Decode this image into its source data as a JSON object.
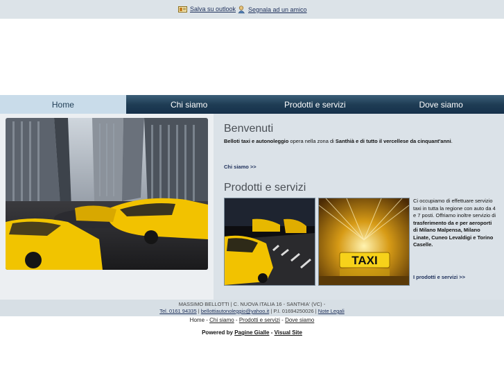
{
  "topbar": {
    "outlook_label": "Salva su outlook",
    "friend_label": "Segnala ad un amico"
  },
  "nav": {
    "items": [
      "Home",
      "Chi siamo",
      "Prodotti e servizi",
      "Dove siamo"
    ],
    "active": "Home"
  },
  "welcome": {
    "title": "Benvenuti",
    "company": "Belloti taxi e autonoleggio",
    "text_1": " opera nella zona di ",
    "place": "Santhià e di tutto il vercellese da cinquant'anni",
    "end": ".",
    "more_link": "Chi siamo >>"
  },
  "services": {
    "title": "Prodotti e servizi",
    "text_1": "Ci occupiamo di effettuare servizio taxi in tutta la regione con auto da 4 e 7 posti. Offriamo inoltre servizio di ",
    "bold": "trasferimento da e per aeroporti di Milano Malpensa, Milano Linate, Cuneo Levaldigi e Torino Caselle.",
    "more_link": "I prodotti e servizi >>",
    "taxi_sign": "TAXI"
  },
  "footer": {
    "line1": "MASSIMO BELLOTTI | C. NUOVA ITALIA 16 - SANTHIA' (VC) -",
    "phone": "Tel. 0161 94335",
    "sep1": " | ",
    "email": "bellottiautonoleggio@yahoo.it",
    "sep2": " | P.I. 01694250026 | ",
    "legal": "Note Legali"
  },
  "bottom_nav": {
    "home": "Home",
    "sep": " - ",
    "chi": "Chi siamo",
    "prodotti": "Prodotti e servizi",
    "dove": "Dove siamo"
  },
  "powered": {
    "label": "Powered by ",
    "pagine": "Pagine Gialle",
    "dash": " - ",
    "visual": "Visual Site"
  },
  "colors": {
    "nav_dark": "#1f3d55",
    "nav_active": "#c9dcea",
    "taxi_yellow": "#f2c200",
    "link": "#1d2f5a"
  }
}
